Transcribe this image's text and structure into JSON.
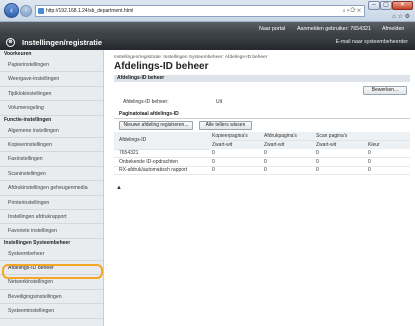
{
  "browser": {
    "url": "http://192.168.1.24/sb_department.html",
    "tools": "⌕ ▾ ⟳ ✕",
    "buttons": {
      "minimize": "–",
      "maximize": "▢",
      "close": "✕"
    },
    "toolbar_icons": "⌂ ☆ ⚙"
  },
  "topbar": {
    "portal": "Naar portal",
    "user_label": "Aanmelden gebruiker: 7654321",
    "logout": "Afmelden"
  },
  "header": {
    "logo_text": "⊗",
    "title": "Instellingen/registratie",
    "mail_link": "E-mail naar systeembeheerder"
  },
  "sidebar": {
    "groups": [
      {
        "title": "Voorkeuren",
        "items": [
          "Papierinstellingen",
          "Weergave-instellingen",
          "Tijdklokinstellingen",
          "Volumeregeling"
        ]
      },
      {
        "title": "Functie-instellingen",
        "items": [
          "Algemene instellingen",
          "Kopieerinstellingen",
          "Faxinstellingen",
          "Scaninstellingen",
          "Afdrukinstellingen geheugenmedia",
          "Printerinstellingen",
          "Instellingen afdrukrapport",
          "Favoriete instellingen"
        ]
      },
      {
        "title": "Instellingen Systeembeheer",
        "items": [
          "Systeembeheer",
          "Afdelings-ID beheer",
          "Netwerkinstellingen",
          "Beveiligingsinstellingen",
          "Systeeminstellingen"
        ]
      }
    ]
  },
  "main": {
    "breadcrumb": "Instellingen/registratie: Instellingen Systeembeheer: Afdelings-ID beheer",
    "page_title": "Afdelings-ID beheer",
    "section_title": "Afdelings-ID beheer",
    "edit_button": "Bewerken...",
    "field_label": "Afdelings-ID beheer:",
    "field_value": "Uit",
    "subsection_title": "Paginatotaal afdelings-ID",
    "new_button": "Nieuwe afdeling registreren...",
    "reset_button": "Alle tellers wissen",
    "table": {
      "col_id": "Afdelings-ID",
      "col_copy": "Kopieerpagina's",
      "col_print": "Afdrukpagina's",
      "col_scan": "Scan pagina's",
      "sub_copy": "Zwart-wit",
      "sub_print": "Zwart-wit",
      "sub_scan1": "Zwart-wit",
      "sub_scan2": "Kleur",
      "rows": [
        {
          "id": "7654321",
          "copy": "0",
          "print": "0",
          "scan_bw": "0",
          "scan_color": "0"
        },
        {
          "id": "Onbekende ID-opdrachten",
          "copy": "0",
          "print": "0",
          "scan_bw": "0",
          "scan_color": "0"
        },
        {
          "id": "RX-afdruk/automatisch rapport",
          "copy": "0",
          "print": "0",
          "scan_bw": "0",
          "scan_color": "0"
        }
      ]
    },
    "top_arrow": "▲"
  }
}
